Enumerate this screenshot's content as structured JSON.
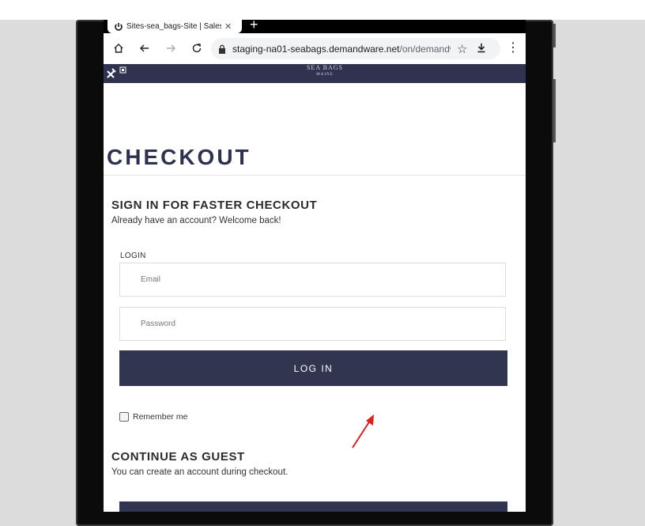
{
  "browser": {
    "tab_title": "Sites-sea_bags-Site | Salesf",
    "tab_close": "✕",
    "new_tab": "+",
    "url_host": "staging-na01-seabags.demandware.net",
    "url_path": "/on/demandware"
  },
  "site": {
    "brand_top": "SEA BAGS",
    "brand_bottom": "MAINE"
  },
  "checkout": {
    "title": "CHECKOUT",
    "signin_heading": "SIGN IN FOR FASTER CHECKOUT",
    "signin_sub": "Already have an account? Welcome back!",
    "login_label": "LOGIN",
    "email_placeholder": "Email",
    "password_placeholder": "Password",
    "login_button": "LOG IN",
    "remember_label": "Remember me",
    "guest_heading": "CONTINUE AS GUEST",
    "guest_sub": "You can create an account during checkout."
  },
  "colors": {
    "brand_navy": "#31354f",
    "annotation_arrow": "#e0201c"
  },
  "icons": [
    "power-icon",
    "home-icon",
    "back-arrow-icon",
    "forward-arrow-icon",
    "reload-icon",
    "lock-icon",
    "star-icon",
    "download-icon",
    "menu-kebab-icon",
    "tools-icon"
  ]
}
